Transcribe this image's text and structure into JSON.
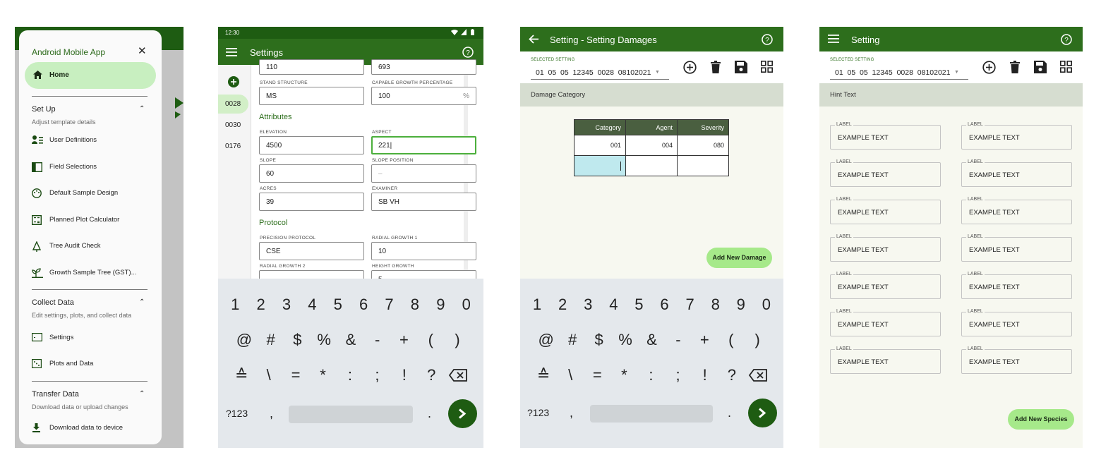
{
  "colors": {
    "primary": "#2d6e1c",
    "primary_dark": "#1e5c12",
    "selected_fill": "#c8efc0",
    "accent_button": "#a6e98a",
    "table_header": "#4a5f40"
  },
  "drawer": {
    "title": "Android Mobile App",
    "home": {
      "label": "Home",
      "icon": "home-icon"
    },
    "setup": {
      "title": "Set Up",
      "subtitle": "Adjust template details",
      "items": [
        {
          "label": "User Definitions",
          "icon": "users-list-icon"
        },
        {
          "label": "Field Selections",
          "icon": "split-panel-icon"
        },
        {
          "label": "Default Sample Design",
          "icon": "palette-icon"
        },
        {
          "label": "Planned Plot Calculator",
          "icon": "calculator-icon"
        },
        {
          "label": "Tree Audit Check",
          "icon": "tree-icon"
        },
        {
          "label": "Growth Sample Tree (GST)...",
          "icon": "growth-icon"
        }
      ]
    },
    "collect": {
      "title": "Collect Data",
      "subtitle": "Edit settings, plots, and collect data",
      "items": [
        {
          "label": "Settings",
          "icon": "settings-square-icon"
        },
        {
          "label": "Plots and Data",
          "icon": "dice-icon"
        }
      ]
    },
    "transfer": {
      "title": "Transfer Data",
      "subtitle": "Download data or upload changes",
      "items": [
        {
          "label": "Download data to device",
          "icon": "download-icon"
        }
      ]
    }
  },
  "settings_screen": {
    "time": "12:30",
    "title": "Settings",
    "plots": [
      "0028",
      "0030",
      "0176"
    ],
    "fields": {
      "top_left": "110",
      "top_right": "693",
      "stand_structure": {
        "label": "STAND STRUCTURE",
        "value": "MS"
      },
      "capable_growth": {
        "label": "CAPABLE GROWTH PERCENTAGE",
        "value": "100",
        "suffix": "%"
      },
      "attributes_header": "Attributes",
      "elevation": {
        "label": "ELEVATION",
        "value": "4500"
      },
      "aspect": {
        "label": "ASPECT",
        "value": "221|"
      },
      "slope": {
        "label": "SLOPE",
        "value": "60"
      },
      "slope_position": {
        "label": "SLOPE POSITION",
        "value": "–"
      },
      "acres": {
        "label": "ACRES",
        "value": "39"
      },
      "examiner": {
        "label": "EXAMINER",
        "value": "SB VH"
      },
      "protocol_header": "Protocol",
      "precision_protocol": {
        "label": "PRECISION PROTOCOL",
        "value": "CSE"
      },
      "radial_growth_1": {
        "label": "RADIAL GROWTH 1",
        "value": "10"
      },
      "radial_growth_2": {
        "label": "RADIAL GROWTH 2",
        "value": "–"
      },
      "height_growth": {
        "label": "HEIGHT GROWTH",
        "value": "5"
      }
    }
  },
  "keyboard": {
    "row1": [
      "1",
      "2",
      "3",
      "4",
      "5",
      "6",
      "7",
      "8",
      "9",
      "0"
    ],
    "row2": [
      "@",
      "#",
      "$",
      "%",
      "&",
      "-",
      "+",
      "(",
      ")"
    ],
    "row3": [
      "≙",
      "\\",
      "=",
      "*",
      ":",
      ";",
      "!",
      "?"
    ],
    "mode_key": "?123",
    "comma": ",",
    "period": "."
  },
  "damages_screen": {
    "title": "Setting - Setting Damages",
    "selected_label": "SELECTED SETTING",
    "selected_value": "01  05  05  12345  0028  08102021",
    "hint": "Damage Category",
    "table": {
      "headers": [
        "Category",
        "Agent",
        "Severity"
      ],
      "rows": [
        [
          "001",
          "004",
          "080"
        ],
        [
          "",
          "",
          ""
        ]
      ]
    },
    "add_button": "Add New Damage"
  },
  "setting_screen": {
    "title": "Setting",
    "selected_label": "SELECTED SETTING",
    "selected_value": "01  05  05  12345  0028  08102021",
    "hint": "Hint Text",
    "field_label": "LABEL",
    "field_value": "EXAMPLE TEXT",
    "add_button": "Add New Species"
  }
}
